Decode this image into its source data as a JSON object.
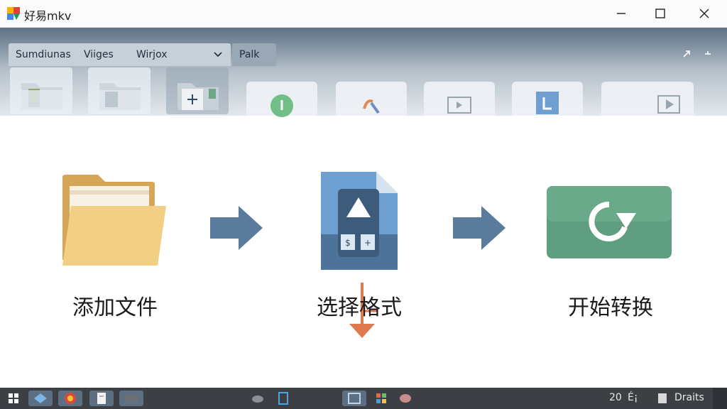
{
  "window": {
    "title": "好易mkv"
  },
  "toolbar": {
    "tabs": [
      "Sumdiunas",
      "Viiges",
      "Wirjox"
    ],
    "pane_tab": "Palk",
    "tool_icons": [
      "folder-icon",
      "folder-icon",
      "folder-add-icon"
    ],
    "action_icons": [
      "info-icon",
      "puzzle-icon",
      "folder-icon",
      "l-icon",
      "play-icon"
    ]
  },
  "steps": [
    {
      "label": "添加文件",
      "icon": "folder-icon"
    },
    {
      "label": "选择格式",
      "icon": "format-file-icon"
    },
    {
      "label": "开始转换",
      "icon": "refresh-icon"
    }
  ],
  "taskbar": {
    "tray_time": "20",
    "tray_mark": "É¡",
    "tray_label": "Draits"
  },
  "colors": {
    "arrow": "#5a7b9b",
    "folder": "#f1cf85",
    "convert": "#5f9e80",
    "format_file": "#5f8fbf"
  }
}
